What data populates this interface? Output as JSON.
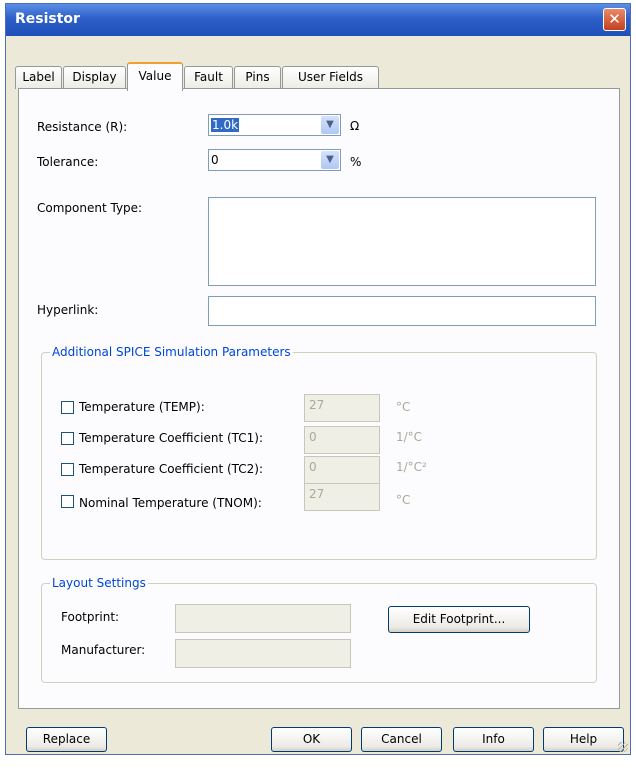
{
  "window": {
    "title": "Resistor",
    "close_symbol": "✕"
  },
  "tabs": [
    {
      "label": "Label"
    },
    {
      "label": "Display"
    },
    {
      "label": "Value"
    },
    {
      "label": "Fault"
    },
    {
      "label": "Pins"
    },
    {
      "label": "User Fields"
    }
  ],
  "active_tab": "Value",
  "value": {
    "resistance": {
      "label": "Resistance (R):",
      "value": "1.0k",
      "unit": "Ω"
    },
    "tolerance": {
      "label": "Tolerance:",
      "value": "0",
      "unit": "%"
    },
    "component_type": {
      "label": "Component Type:",
      "value": ""
    },
    "hyperlink": {
      "label": "Hyperlink:",
      "value": ""
    }
  },
  "spice": {
    "title": "Additional SPICE Simulation Parameters",
    "params": [
      {
        "label": "Temperature (TEMP):",
        "value": "27",
        "unit": "°C",
        "checked": false
      },
      {
        "label": "Temperature Coefficient (TC1):",
        "value": "0",
        "unit": "1/°C",
        "checked": false
      },
      {
        "label": "Temperature Coefficient (TC2):",
        "value": "0",
        "unit": "1/°C²",
        "checked": false
      },
      {
        "label": "Nominal Temperature (TNOM):",
        "value": "27",
        "unit": "°C",
        "checked": false
      }
    ]
  },
  "layout": {
    "title": "Layout Settings",
    "footprint_label": "Footprint:",
    "footprint_value": "",
    "manufacturer_label": "Manufacturer:",
    "manufacturer_value": "",
    "edit_button": "Edit Footprint..."
  },
  "buttons": {
    "replace": "Replace",
    "ok": "OK",
    "cancel": "Cancel",
    "info": "Info",
    "help": "Help"
  },
  "icons": {
    "dropdown": "chevron-down-icon",
    "close": "close-icon"
  }
}
